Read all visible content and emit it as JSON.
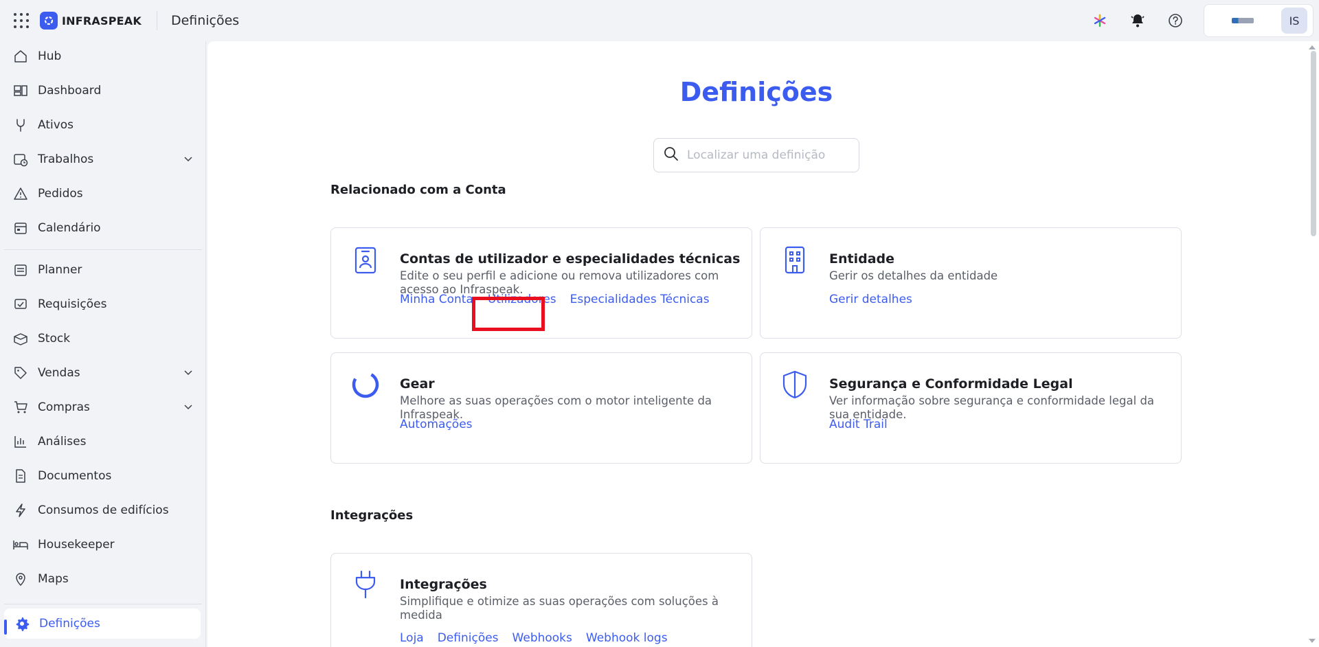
{
  "app": {
    "brand": "INFRASPEAK",
    "title": "Definições",
    "avatar_initials": "IS"
  },
  "colors": {
    "accent": "#3c5cf0",
    "highlight": "#e8101e"
  },
  "icons": {
    "top": [
      "apps-grid-icon",
      "sparkle-icon",
      "bell-icon",
      "help-icon"
    ]
  },
  "sidebar": {
    "items": [
      {
        "label": "Hub",
        "icon": "home-icon"
      },
      {
        "label": "Dashboard",
        "icon": "dashboard-icon"
      },
      {
        "label": "Ativos",
        "icon": "wrench-icon"
      },
      {
        "label": "Trabalhos",
        "icon": "calendar-clock-icon",
        "expandable": true
      },
      {
        "label": "Pedidos",
        "icon": "warning-icon"
      },
      {
        "label": "Calendário",
        "icon": "calendar-icon"
      },
      {
        "label": "Planner",
        "icon": "planner-icon"
      },
      {
        "label": "Requisições",
        "icon": "requisition-icon"
      },
      {
        "label": "Stock",
        "icon": "box-icon"
      },
      {
        "label": "Vendas",
        "icon": "tag-icon",
        "expandable": true
      },
      {
        "label": "Compras",
        "icon": "cart-icon",
        "expandable": true
      },
      {
        "label": "Análises",
        "icon": "bar-chart-icon"
      },
      {
        "label": "Documentos",
        "icon": "document-icon"
      },
      {
        "label": "Consumos de edifícios",
        "icon": "lightning-icon"
      },
      {
        "label": "Housekeeper",
        "icon": "bed-icon"
      },
      {
        "label": "Maps",
        "icon": "map-pin-icon"
      },
      {
        "label": "Definições",
        "icon": "gear-icon",
        "active": true
      }
    ]
  },
  "main": {
    "title": "Definições",
    "search": {
      "placeholder": "Localizar uma definição",
      "value": ""
    },
    "sections": [
      {
        "title": "Relacionado com a Conta",
        "cards": [
          {
            "title": "Contas de utilizador e especialidades técnicas",
            "description": "Edite o seu perfil e adicione ou remova utilizadores com acesso ao Infraspeak.",
            "links": [
              "Minha Conta",
              "Utilizadores",
              "Especialidades Técnicas"
            ],
            "icon": "id-badge-icon"
          },
          {
            "title": "Entidade",
            "description": "Gerir os detalhes da entidade",
            "links": [
              "Gerir detalhes"
            ],
            "icon": "building-icon"
          },
          {
            "title": "Gear",
            "description": "Melhore as suas operações com o motor inteligente da Infraspeak.",
            "links": [
              "Automações"
            ],
            "icon": "gear-ring-icon"
          },
          {
            "title": "Segurança e Conformidade Legal",
            "description": "Ver informação sobre segurança e conformidade legal da sua entidade.",
            "links": [
              "Audit Trail"
            ],
            "icon": "shield-icon"
          }
        ]
      },
      {
        "title": "Integrações",
        "cards": [
          {
            "title": "Integrações",
            "description": "Simplifique e otimize as suas operações com soluções à medida",
            "links": [
              "Loja",
              "Definições",
              "Webhooks",
              "Webhook logs"
            ],
            "icon": "plug-icon"
          }
        ]
      }
    ],
    "highlighted_link": "Utilizadores"
  }
}
